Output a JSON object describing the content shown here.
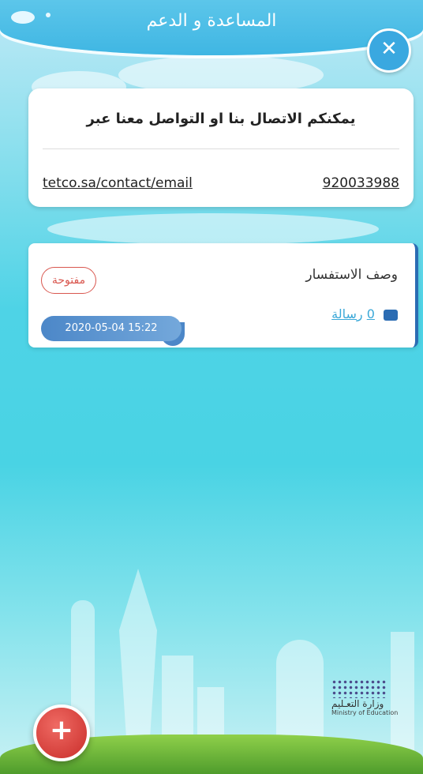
{
  "header": {
    "title": "المساعدة و الدعم"
  },
  "contact": {
    "title": "يمكنكم الاتصال بنا او التواصل معنا عبر",
    "email_link": "tetco.sa/contact/email",
    "phone_link": "920033988"
  },
  "inquiry": {
    "title": "وصف الاستفسار",
    "status": "مفتوحة",
    "message_count": "0",
    "message_label": "رسالة",
    "date": "2020-05-04 15:22"
  },
  "ministry": {
    "arabic": "وزارة التعـليم",
    "english": "Ministry of Education"
  },
  "icons": {
    "close": "close-icon",
    "message": "message-icon",
    "add": "plus-icon"
  },
  "colors": {
    "accent_blue": "#2b6cb3",
    "status_red": "#d9574f",
    "add_button": "#d9433e"
  }
}
